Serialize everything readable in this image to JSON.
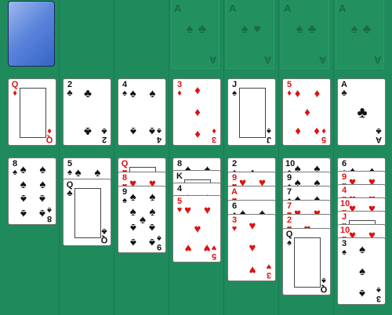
{
  "colors": {
    "felt": "#1f8a5c",
    "red": "#e01010",
    "black": "#111111",
    "card_back": "#3563c6"
  },
  "stock": {
    "icon": "card-back"
  },
  "foundations": [
    {
      "rank": "A",
      "suits": [
        "♠",
        "♣"
      ]
    },
    {
      "rank": "A",
      "suits": [
        "♠",
        "♥"
      ]
    },
    {
      "rank": "A",
      "suits": [
        "♠",
        "♣"
      ]
    },
    {
      "rank": "A",
      "suits": [
        "♠",
        "♣"
      ]
    }
  ],
  "reserve": [
    {
      "rank": "Q",
      "suit": "♦",
      "color": "red",
      "face": true
    },
    {
      "rank": "2",
      "suit": "♣",
      "color": "black"
    },
    {
      "rank": "4",
      "suit": "♠",
      "color": "black"
    },
    {
      "rank": "3",
      "suit": "♦",
      "color": "red"
    },
    {
      "rank": "J",
      "suit": "♠",
      "color": "black",
      "face": true
    },
    {
      "rank": "5",
      "suit": "♦",
      "color": "red"
    },
    {
      "rank": "A",
      "suit": "♣",
      "color": "black"
    }
  ],
  "tableau": [
    [
      {
        "rank": "8",
        "suit": "♠",
        "color": "black"
      }
    ],
    [
      {
        "rank": "5",
        "suit": "♠",
        "color": "black"
      },
      {
        "rank": "Q",
        "suit": "♣",
        "color": "black",
        "face": true
      }
    ],
    [
      {
        "rank": "Q",
        "suit": "♥",
        "color": "red",
        "face": true
      },
      {
        "rank": "8",
        "suit": "♥",
        "color": "red"
      },
      {
        "rank": "9",
        "suit": "♠",
        "color": "black"
      }
    ],
    [
      {
        "rank": "8",
        "suit": "♠",
        "color": "black"
      },
      {
        "rank": "K",
        "suit": "♠",
        "color": "black",
        "face": true
      },
      {
        "rank": "4",
        "suit": "♠",
        "color": "black"
      },
      {
        "rank": "5",
        "suit": "♥",
        "color": "red"
      }
    ],
    [
      {
        "rank": "2",
        "suit": "♠",
        "color": "black"
      },
      {
        "rank": "9",
        "suit": "♥",
        "color": "red"
      },
      {
        "rank": "A",
        "suit": "♥",
        "color": "red"
      },
      {
        "rank": "6",
        "suit": "♠",
        "color": "black"
      },
      {
        "rank": "3",
        "suit": "♥",
        "color": "red"
      }
    ],
    [
      {
        "rank": "10",
        "suit": "♠",
        "color": "black"
      },
      {
        "rank": "9",
        "suit": "♠",
        "color": "black"
      },
      {
        "rank": "7",
        "suit": "♠",
        "color": "black"
      },
      {
        "rank": "7",
        "suit": "♥",
        "color": "red"
      },
      {
        "rank": "2",
        "suit": "♥",
        "color": "red"
      },
      {
        "rank": "Q",
        "suit": "♠",
        "color": "black",
        "face": true
      }
    ],
    [
      {
        "rank": "6",
        "suit": "♠",
        "color": "black"
      },
      {
        "rank": "9",
        "suit": "♥",
        "color": "red"
      },
      {
        "rank": "4",
        "suit": "♥",
        "color": "red"
      },
      {
        "rank": "10",
        "suit": "♥",
        "color": "red"
      },
      {
        "rank": "J",
        "suit": "♥",
        "color": "red",
        "face": true
      },
      {
        "rank": "10",
        "suit": "♥",
        "color": "red"
      },
      {
        "rank": "3",
        "suit": "♠",
        "color": "black"
      }
    ]
  ]
}
